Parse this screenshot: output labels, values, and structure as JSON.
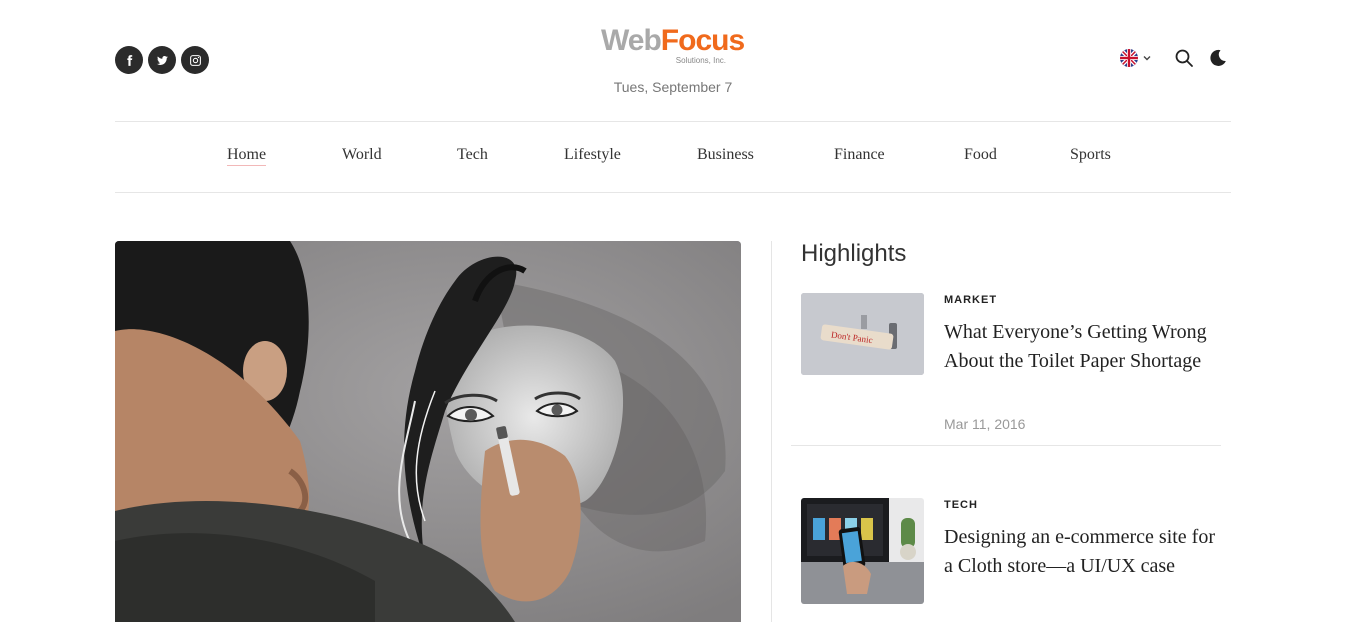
{
  "header": {
    "logo_web": "Web",
    "logo_focus": "Focus",
    "logo_tagline": "Solutions, Inc.",
    "date": "Tues, September 7",
    "social": [
      "facebook-icon",
      "twitter-icon",
      "instagram-icon"
    ],
    "tools": [
      "uk-flag-icon",
      "chevron-down-icon",
      "search-icon",
      "moon-icon"
    ]
  },
  "nav": {
    "items": [
      {
        "label": "Home"
      },
      {
        "label": "World"
      },
      {
        "label": "Tech"
      },
      {
        "label": "Lifestyle"
      },
      {
        "label": "Business"
      },
      {
        "label": "Finance"
      },
      {
        "label": "Food"
      },
      {
        "label": "Sports"
      }
    ]
  },
  "highlights": {
    "title": "Highlights",
    "cards": [
      {
        "category": "MARKET",
        "title": "What Everyone’s Getting Wrong About the Toilet Paper Shortage",
        "date": "Mar 11, 2016",
        "thumb_text": "Don't Panic"
      },
      {
        "category": "TECH",
        "title": "Designing an e-commerce site for a Cloth store—a UI/UX case",
        "date": ""
      }
    ]
  },
  "colors": {
    "accent": "#f06a1c",
    "logo_grey": "#a9a9a9",
    "text": "#222222",
    "muted": "#999999"
  }
}
